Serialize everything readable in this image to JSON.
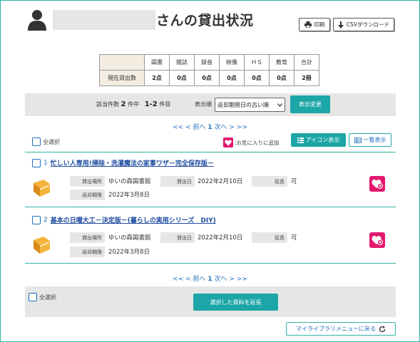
{
  "header": {
    "title": "さんの貸出状況",
    "print_label": "印刷",
    "csv_label": "CSVダウンロード"
  },
  "summary": {
    "row_label": "現在貸出数",
    "columns": [
      "図書",
      "雑誌",
      "録音",
      "映像",
      "ＨＳ",
      "教育",
      "合計"
    ],
    "values": [
      "2点",
      "0点",
      "0点",
      "0点",
      "0点",
      "0点",
      "2冊"
    ]
  },
  "filter": {
    "count_prefix": "該当件数",
    "count_total": "2",
    "count_mid": "件中",
    "count_range": "1-2",
    "count_suffix": "件目",
    "sort_label": "表示順",
    "sort_value": "返却期限日の古い順",
    "apply_label": "表示変更"
  },
  "pager": {
    "first": "<<",
    "prev": "< 前へ",
    "current": "1",
    "next": "次へ >",
    "last": ">>"
  },
  "toolbar": {
    "select_all": "全選択",
    "fav_note": ":お気に入りに追加",
    "icon_view": "アイコン表示",
    "list_view": "一覧表示"
  },
  "items": [
    {
      "num": "1",
      "title": "忙しい人専用!掃除・洗濯魔法の家事ワザ－完全保存版－",
      "place_label": "貸出場所",
      "place": "ゆいの森図書館",
      "date_label": "貸出日",
      "date": "2022年2月10日",
      "extend_label": "延長",
      "extend": "可",
      "due_label": "返却期限",
      "due": "2022年3月8日"
    },
    {
      "num": "2",
      "title": "基本の日曜大工－決定版－(暮らしの実用シリーズ　DIY)",
      "place_label": "貸出場所",
      "place": "ゆいの森図書館",
      "date_label": "貸出日",
      "date": "2022年2月10日",
      "extend_label": "延長",
      "extend": "可",
      "due_label": "返却期限",
      "due": "2022年3月8日"
    }
  ],
  "bottom": {
    "select_all": "全選択",
    "extend_button": "選択した資料を延長",
    "back_button": "マイライブラリメニューに戻る"
  },
  "colors": {
    "accent": "#1da6a8",
    "border": "#2fb3a4",
    "favorite": "#e2186e",
    "link": "#1e6fbf"
  },
  "icons": {
    "user": "user-icon",
    "print": "printer-icon",
    "csv": "download-icon",
    "heart": "heart-plus-icon",
    "book": "book-icon",
    "back": "refresh-icon"
  }
}
